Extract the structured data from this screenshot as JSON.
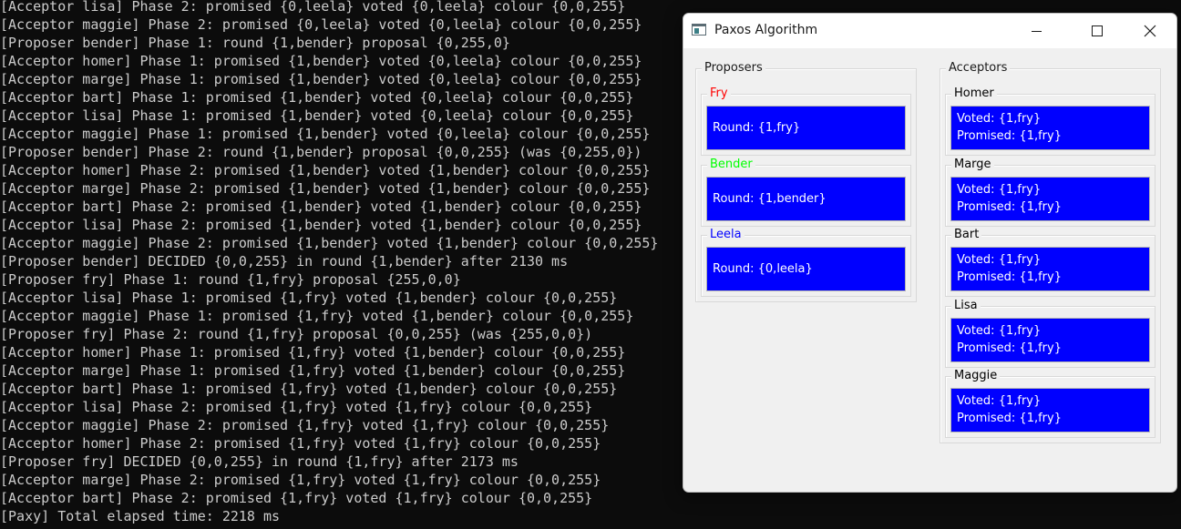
{
  "terminal": {
    "lines": [
      "[Acceptor lisa] Phase 2: promised {0,leela} voted {0,leela} colour {0,0,255}",
      "[Acceptor maggie] Phase 2: promised {0,leela} voted {0,leela} colour {0,0,255}",
      "[Proposer bender] Phase 1: round {1,bender} proposal {0,255,0}",
      "[Acceptor homer] Phase 1: promised {1,bender} voted {0,leela} colour {0,0,255}",
      "[Acceptor marge] Phase 1: promised {1,bender} voted {0,leela} colour {0,0,255}",
      "[Acceptor bart] Phase 1: promised {1,bender} voted {0,leela} colour {0,0,255}",
      "[Acceptor lisa] Phase 1: promised {1,bender} voted {0,leela} colour {0,0,255}",
      "[Acceptor maggie] Phase 1: promised {1,bender} voted {0,leela} colour {0,0,255}",
      "[Proposer bender] Phase 2: round {1,bender} proposal {0,0,255} (was {0,255,0})",
      "[Acceptor homer] Phase 2: promised {1,bender} voted {1,bender} colour {0,0,255}",
      "[Acceptor marge] Phase 2: promised {1,bender} voted {1,bender} colour {0,0,255}",
      "[Acceptor bart] Phase 2: promised {1,bender} voted {1,bender} colour {0,0,255}",
      "[Acceptor lisa] Phase 2: promised {1,bender} voted {1,bender} colour {0,0,255}",
      "[Acceptor maggie] Phase 2: promised {1,bender} voted {1,bender} colour {0,0,255}",
      "[Proposer bender] DECIDED {0,0,255} in round {1,bender} after 2130 ms",
      "[Proposer fry] Phase 1: round {1,fry} proposal {255,0,0}",
      "[Acceptor lisa] Phase 1: promised {1,fry} voted {1,bender} colour {0,0,255}",
      "[Acceptor maggie] Phase 1: promised {1,fry} voted {1,bender} colour {0,0,255}",
      "[Proposer fry] Phase 2: round {1,fry} proposal {0,0,255} (was {255,0,0})",
      "[Acceptor homer] Phase 1: promised {1,fry} voted {1,bender} colour {0,0,255}",
      "[Acceptor marge] Phase 1: promised {1,fry} voted {1,bender} colour {0,0,255}",
      "[Acceptor bart] Phase 1: promised {1,fry} voted {1,bender} colour {0,0,255}",
      "[Acceptor lisa] Phase 2: promised {1,fry} voted {1,fry} colour {0,0,255}",
      "[Acceptor maggie] Phase 2: promised {1,fry} voted {1,fry} colour {0,0,255}",
      "[Acceptor homer] Phase 2: promised {1,fry} voted {1,fry} colour {0,0,255}",
      "[Proposer fry] DECIDED {0,0,255} in round {1,fry} after 2173 ms",
      "[Acceptor marge] Phase 2: promised {1,fry} voted {1,fry} colour {0,0,255}",
      "[Acceptor bart] Phase 2: promised {1,fry} voted {1,fry} colour {0,0,255}",
      "[Paxy] Total elapsed time: 2218 ms"
    ]
  },
  "window": {
    "title": "Paxos Algorithm",
    "icon": "app-window-icon",
    "controls": {
      "minimize": "minimize-icon",
      "maximize": "maximize-icon",
      "close": "close-icon"
    }
  },
  "proposers": {
    "title": "Proposers",
    "items": [
      {
        "name": "Fry",
        "name_color": "#ff0000",
        "round": "Round: {1,fry}"
      },
      {
        "name": "Bender",
        "name_color": "#00ff00",
        "round": "Round: {1,bender}"
      },
      {
        "name": "Leela",
        "name_color": "#0000ff",
        "round": "Round: {0,leela}"
      }
    ]
  },
  "acceptors": {
    "title": "Acceptors",
    "items": [
      {
        "name": "Homer",
        "voted": "Voted: {1,fry}",
        "promised": "Promised: {1,fry}"
      },
      {
        "name": "Marge",
        "voted": "Voted: {1,fry}",
        "promised": "Promised: {1,fry}"
      },
      {
        "name": "Bart",
        "voted": "Voted: {1,fry}",
        "promised": "Promised: {1,fry}"
      },
      {
        "name": "Lisa",
        "voted": "Voted: {1,fry}",
        "promised": "Promised: {1,fry}"
      },
      {
        "name": "Maggie",
        "voted": "Voted: {1,fry}",
        "promised": "Promised: {1,fry}"
      }
    ]
  },
  "colors": {
    "terminal_bg": "#0c0c0c",
    "terminal_text": "#cccccc",
    "window_bg": "#f0f0f0",
    "state_box": "#0000ff",
    "state_text": "#ffffff"
  }
}
